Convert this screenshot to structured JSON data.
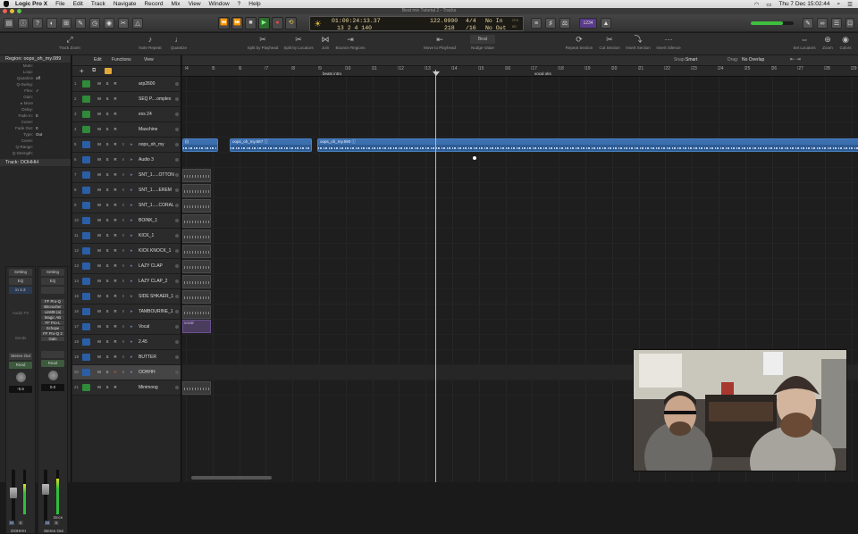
{
  "menubar": {
    "app": "Logic Pro X",
    "items": [
      "File",
      "Edit",
      "Track",
      "Navigate",
      "Record",
      "Mix",
      "View",
      "Window",
      "?",
      "Help"
    ],
    "clock": "Thu 7 Dec  15:02:44"
  },
  "window_title": "Beat mix Tutorial 2 - Tracks",
  "lcd": {
    "time": "01:00:24:13.37",
    "bars": "13  2  4  140",
    "tempo": "122.0000",
    "keep": "218",
    "sig": "4/4",
    "division": "/16",
    "in": "No In",
    "out": "No Out",
    "label_cpu": "CPU",
    "label_hd": "HD"
  },
  "transport": [
    "⏪",
    "⏩",
    "■",
    "▶",
    "●",
    "⟲"
  ],
  "control_tools": [
    {
      "label": "Track Zoom",
      "icon": "⤢"
    },
    {
      "label": "Note Repeat",
      "icon": "♪"
    },
    {
      "label": "Quantize",
      "icon": "♩"
    },
    {
      "label": "Split by Playhead",
      "icon": "✂"
    },
    {
      "label": "Split by Locators",
      "icon": "✂"
    },
    {
      "label": "Join",
      "icon": "⋈"
    },
    {
      "label": "Bounce Regions",
      "icon": "⇥"
    },
    {
      "label": "Move to Playhead",
      "icon": "⇤"
    },
    {
      "label": "Nudge Value",
      "icon": "⇆"
    },
    {
      "label": "Repeat Section",
      "icon": "⟳"
    },
    {
      "label": "Cut Section",
      "icon": "✂"
    },
    {
      "label": "Insert Section",
      "icon": "⤵"
    },
    {
      "label": "Insert Silence",
      "icon": "⋯"
    },
    {
      "label": "Set Locators",
      "icon": "⇔"
    },
    {
      "label": "Zoom",
      "icon": "⊕"
    },
    {
      "label": "Colors",
      "icon": "◉"
    }
  ],
  "nudge_value": "Beat",
  "inspector": {
    "region_title": "Region: oops_oh_my.089",
    "rows": [
      {
        "k": "Mute:",
        "v": ""
      },
      {
        "k": "Loop:",
        "v": ""
      },
      {
        "k": "Quantize",
        "v": "off"
      },
      {
        "k": "Q-Swing:",
        "v": ""
      },
      {
        "k": "Flex:",
        "v": "✓"
      },
      {
        "k": "Gain:",
        "v": ""
      },
      {
        "k": "▸ More",
        "v": ""
      },
      {
        "k": "Delay:",
        "v": ""
      },
      {
        "k": "Fade In:",
        "v": "0"
      },
      {
        "k": "Curve:",
        "v": ""
      },
      {
        "k": "Fade Out:",
        "v": "0"
      },
      {
        "k": "Type:",
        "v": "Out"
      },
      {
        "k": "Curve:",
        "v": ""
      },
      {
        "k": "Q-Range:",
        "v": ""
      },
      {
        "k": "Q-Strength:",
        "v": ""
      }
    ],
    "track_title": "Track:  OOHHH"
  },
  "strips": [
    {
      "setting": "Setting",
      "eq": "EQ",
      "input": "in 1-2",
      "audio_fx": "Audio FX",
      "sends": "Sends",
      "output": "Stereo Out",
      "automation": "Read",
      "volume": "-5.6",
      "name": "OOHHH",
      "ms": [
        "M",
        "S"
      ]
    },
    {
      "setting": "Setting",
      "eq": "EQ",
      "input": "",
      "plugins": [
        "FF Pro-Q",
        "Bitcrusher",
        "LinMB (a)",
        "Magic AB",
        "FF Pro-L",
        "Schope",
        "FF Pro-Q 2",
        "Gain"
      ],
      "output": "",
      "automation": "Read",
      "volume": "0.0",
      "name": "Stereo Out",
      "bnce": "Bnce",
      "ms": [
        "M",
        "S"
      ]
    }
  ],
  "track_header": {
    "edit": "Edit",
    "functions": "Functions",
    "view": "View"
  },
  "tracks": [
    {
      "n": "1",
      "name": "arp2600",
      "color": "#2f8a3a"
    },
    {
      "n": "2",
      "name": "SEQ P....omplex",
      "color": "#2f8a3a"
    },
    {
      "n": "3",
      "name": "exs 24",
      "color": "#2f8a3a"
    },
    {
      "n": "4",
      "name": "Maschine",
      "color": "#2f8a3a"
    },
    {
      "n": "5",
      "name": "oops_oh_my",
      "color": "#2a5fa8"
    },
    {
      "n": "6",
      "name": "Audio 3",
      "color": "#2a5fa8"
    },
    {
      "n": "7",
      "name": "SNT_1.....OTTON",
      "color": "#2a5fa8"
    },
    {
      "n": "8",
      "name": "SNT_1.....EREM",
      "color": "#2a5fa8"
    },
    {
      "n": "9",
      "name": "SNT_1.....CORAL",
      "color": "#2a5fa8"
    },
    {
      "n": "10",
      "name": "BOINK_1",
      "color": "#2a5fa8"
    },
    {
      "n": "11",
      "name": "KICK_1",
      "color": "#2a5fa8"
    },
    {
      "n": "12",
      "name": "KICK KNOCK_1",
      "color": "#2a5fa8"
    },
    {
      "n": "13",
      "name": "LAZY CLAP",
      "color": "#2a5fa8"
    },
    {
      "n": "14",
      "name": "LAZY CLAP_2",
      "color": "#2a5fa8"
    },
    {
      "n": "15",
      "name": "SIDE SHKAER_1",
      "color": "#2a5fa8"
    },
    {
      "n": "16",
      "name": "TAMBOURINE_1",
      "color": "#2a5fa8"
    },
    {
      "n": "17",
      "name": "Vocal",
      "color": "#2a5fa8"
    },
    {
      "n": "18",
      "name": "2.45",
      "color": "#2a5fa8"
    },
    {
      "n": "19",
      "name": "BUTTER",
      "color": "#2a5fa8"
    },
    {
      "n": "20",
      "name": "OOHHH",
      "color": "#2a5fa8"
    },
    {
      "n": "21",
      "name": "Minimoog",
      "color": "#2f8a3a"
    }
  ],
  "arrange": {
    "edit": "Edit",
    "functions": "Functions",
    "view": "View",
    "snap_label": "Snap:",
    "snap": "Smart",
    "drag_label": "Drag:",
    "drag": "No Overlap",
    "bars": [
      "4",
      "5",
      "6",
      "7",
      "8",
      "9",
      "10",
      "11",
      "12",
      "13",
      "14",
      "15",
      "16",
      "17",
      "18",
      "19",
      "20",
      "21",
      "22",
      "23",
      "24",
      "25",
      "26",
      "27",
      "28",
      "29"
    ],
    "markers": [
      {
        "label": "beats intro"
      },
      {
        "label": "vocal oks"
      }
    ],
    "regions": [
      {
        "label": "oops_oh_my.587",
        "icon": "ⓘ"
      },
      {
        "label": "oops_oh_my.590",
        "icon": "ⓘ"
      }
    ],
    "region_stub": "(i)",
    "vocal_region": "vocal"
  },
  "colors": {
    "accent": "#2e5c95",
    "play": "#2fbf3c",
    "record": "#d23a3a",
    "lcd": "#e8d9a6"
  }
}
